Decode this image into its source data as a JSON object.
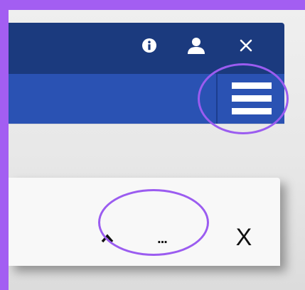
{
  "header": {
    "icons": [
      "info-icon",
      "user-icon",
      "close-icon"
    ]
  },
  "navbar": {
    "menu_icon": "hamburger-menu-icon"
  },
  "findbar": {
    "up_icon": "chevron-up-icon",
    "more_label": "...",
    "close_label": "X"
  },
  "colors": {
    "frame": "#a35ef2",
    "header_bg": "#1b3a7e",
    "navbar_bg": "#2a52b3",
    "highlight": "#9b5cf0"
  }
}
